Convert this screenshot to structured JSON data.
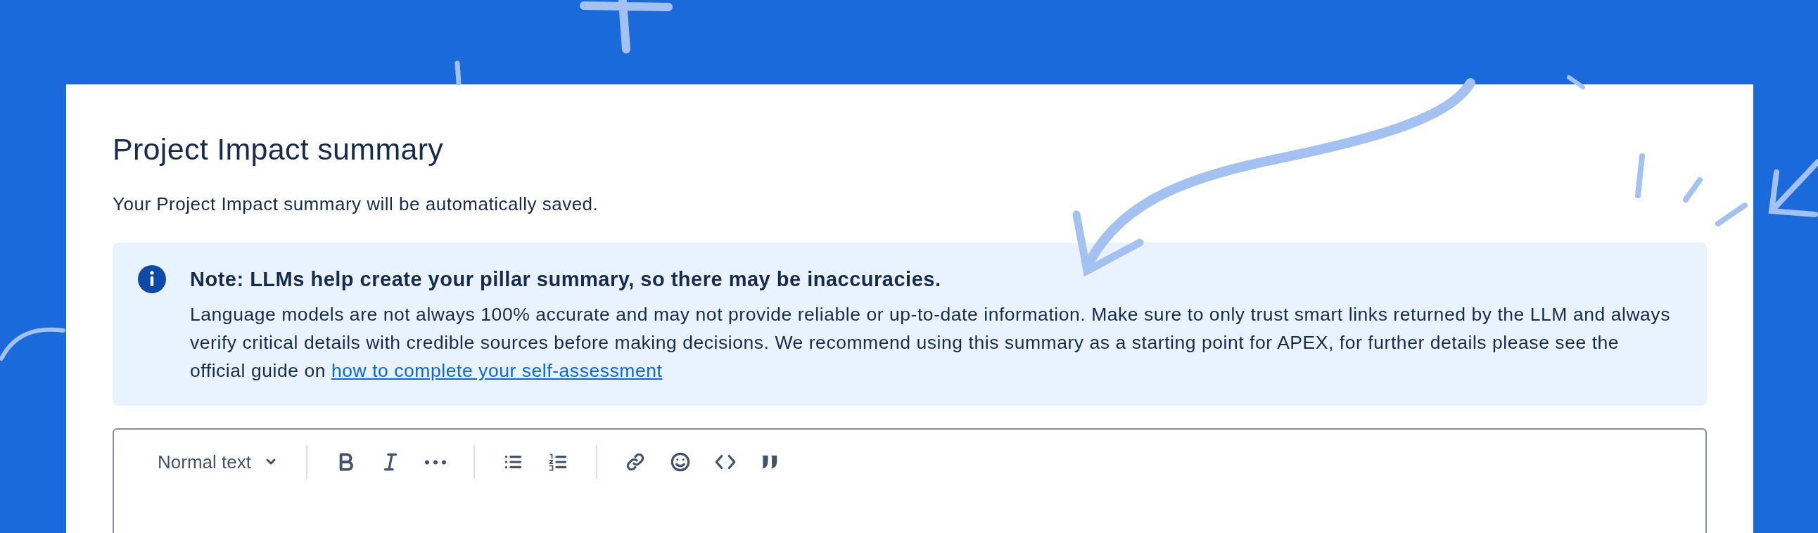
{
  "title": "Project Impact summary",
  "subtitle": "Your Project Impact summary will be automatically saved.",
  "note": {
    "heading": "Note: LLMs help create your pillar summary, so there may be inaccuracies.",
    "body": "Language models are not always 100% accurate and may not provide reliable or up-to-date information. Make sure to only trust smart links returned by the LLM and always verify critical details with credible sources before making decisions. We recommend using this summary as a starting point for APEX, for further details please see the official guide on",
    "link": "how to complete your self-assessment"
  },
  "editor": {
    "text_style": "Normal text",
    "toolbar": [
      {
        "kind": "bold"
      },
      {
        "kind": "italic"
      },
      {
        "kind": "more"
      },
      {
        "kind": "bullet-list"
      },
      {
        "kind": "numbered-list"
      },
      {
        "kind": "link"
      },
      {
        "kind": "emoji"
      },
      {
        "kind": "code"
      },
      {
        "kind": "quote"
      }
    ]
  }
}
